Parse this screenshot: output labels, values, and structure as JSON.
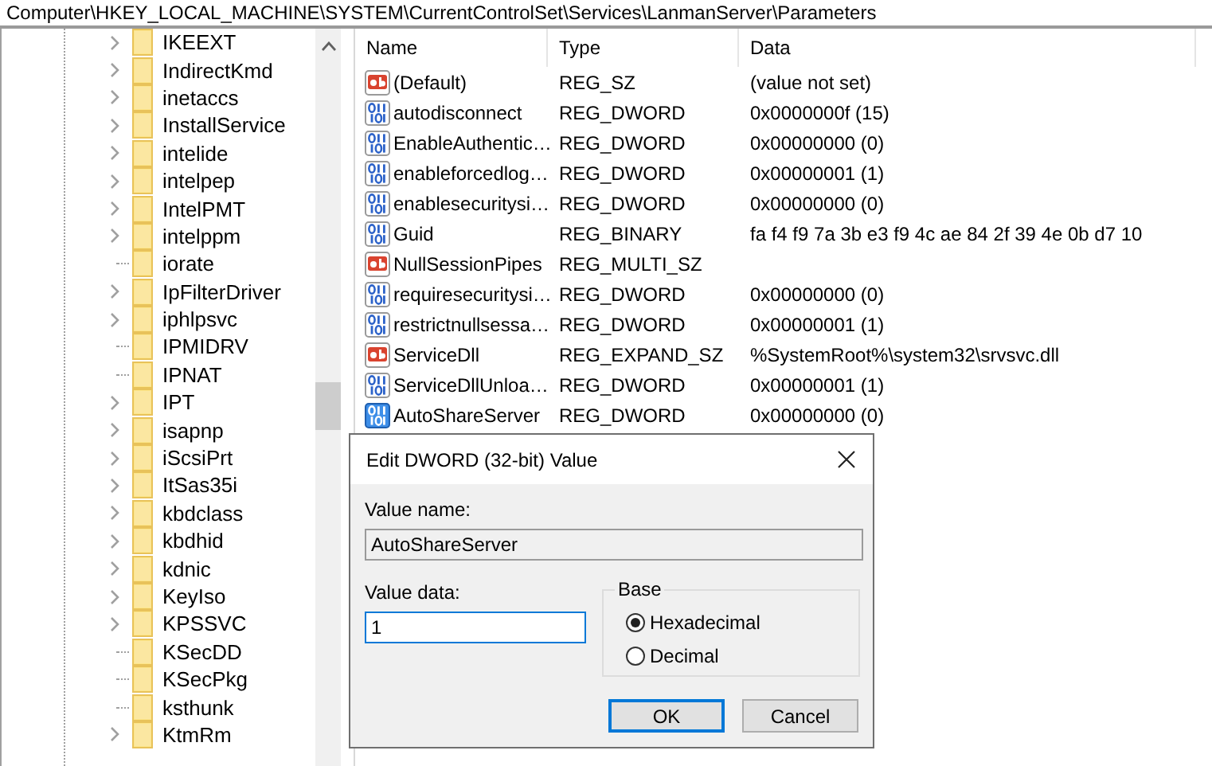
{
  "address_bar": {
    "path": "Computer\\HKEY_LOCAL_MACHINE\\SYSTEM\\CurrentControlSet\\Services\\LanmanServer\\Parameters"
  },
  "tree": {
    "items": [
      {
        "label": "IKEEXT",
        "expandable": true
      },
      {
        "label": "IndirectKmd",
        "expandable": true
      },
      {
        "label": "inetaccs",
        "expandable": true
      },
      {
        "label": "InstallService",
        "expandable": true
      },
      {
        "label": "intelide",
        "expandable": true
      },
      {
        "label": "intelpep",
        "expandable": true
      },
      {
        "label": "IntelPMT",
        "expandable": true
      },
      {
        "label": "intelppm",
        "expandable": true
      },
      {
        "label": "iorate",
        "expandable": false
      },
      {
        "label": "IpFilterDriver",
        "expandable": true
      },
      {
        "label": "iphlpsvc",
        "expandable": true
      },
      {
        "label": "IPMIDRV",
        "expandable": false
      },
      {
        "label": "IPNAT",
        "expandable": false
      },
      {
        "label": "IPT",
        "expandable": true
      },
      {
        "label": "isapnp",
        "expandable": true
      },
      {
        "label": "iScsiPrt",
        "expandable": true
      },
      {
        "label": "ItSas35i",
        "expandable": true
      },
      {
        "label": "kbdclass",
        "expandable": true
      },
      {
        "label": "kbdhid",
        "expandable": true
      },
      {
        "label": "kdnic",
        "expandable": true
      },
      {
        "label": "KeyIso",
        "expandable": true
      },
      {
        "label": "KPSSVC",
        "expandable": true
      },
      {
        "label": "KSecDD",
        "expandable": false
      },
      {
        "label": "KSecPkg",
        "expandable": false
      },
      {
        "label": "ksthunk",
        "expandable": false
      },
      {
        "label": "KtmRm",
        "expandable": true
      }
    ]
  },
  "values": {
    "columns": [
      "Name",
      "Type",
      "Data"
    ],
    "rows": [
      {
        "kind": "string",
        "name": "(Default)",
        "type": "REG_SZ",
        "data": "(value not set)",
        "selected": false
      },
      {
        "kind": "binary",
        "name": "autodisconnect",
        "type": "REG_DWORD",
        "data": "0x0000000f (15)",
        "selected": false
      },
      {
        "kind": "binary",
        "name": "EnableAuthentic…",
        "type": "REG_DWORD",
        "data": "0x00000000 (0)",
        "selected": false
      },
      {
        "kind": "binary",
        "name": "enableforcedlog…",
        "type": "REG_DWORD",
        "data": "0x00000001 (1)",
        "selected": false
      },
      {
        "kind": "binary",
        "name": "enablesecuritysi…",
        "type": "REG_DWORD",
        "data": "0x00000000 (0)",
        "selected": false
      },
      {
        "kind": "binary",
        "name": "Guid",
        "type": "REG_BINARY",
        "data": "fa f4 f9 7a 3b e3 f9 4c ae 84 2f 39 4e 0b d7 10",
        "selected": false
      },
      {
        "kind": "string",
        "name": "NullSessionPipes",
        "type": "REG_MULTI_SZ",
        "selected": false
      },
      {
        "kind": "binary",
        "name": "requiresecuritysi…",
        "type": "REG_DWORD",
        "data": "0x00000000 (0)",
        "selected": false
      },
      {
        "kind": "binary",
        "name": "restrictnullsessa…",
        "type": "REG_DWORD",
        "data": "0x00000001 (1)",
        "selected": false
      },
      {
        "kind": "string",
        "name": "ServiceDll",
        "type": "REG_EXPAND_SZ",
        "data": "%SystemRoot%\\system32\\srvsvc.dll",
        "selected": false
      },
      {
        "kind": "binary",
        "name": "ServiceDllUnloa…",
        "type": "REG_DWORD",
        "data": "0x00000001 (1)",
        "selected": false
      },
      {
        "kind": "binary",
        "name": "AutoShareServer",
        "type": "REG_DWORD",
        "data": "0x00000000 (0)",
        "selected": true
      }
    ]
  },
  "dialog": {
    "title": "Edit DWORD (32-bit) Value",
    "value_name_label": "Value name:",
    "value_name": "AutoShareServer",
    "value_data_label": "Value data:",
    "value_data": "1",
    "base": {
      "label": "Base",
      "options": [
        {
          "label": "Hexadecimal",
          "selected": true
        },
        {
          "label": "Decimal",
          "selected": false
        }
      ]
    },
    "buttons": [
      {
        "label": "OK",
        "default": true
      },
      {
        "label": "Cancel",
        "default": false
      }
    ]
  }
}
